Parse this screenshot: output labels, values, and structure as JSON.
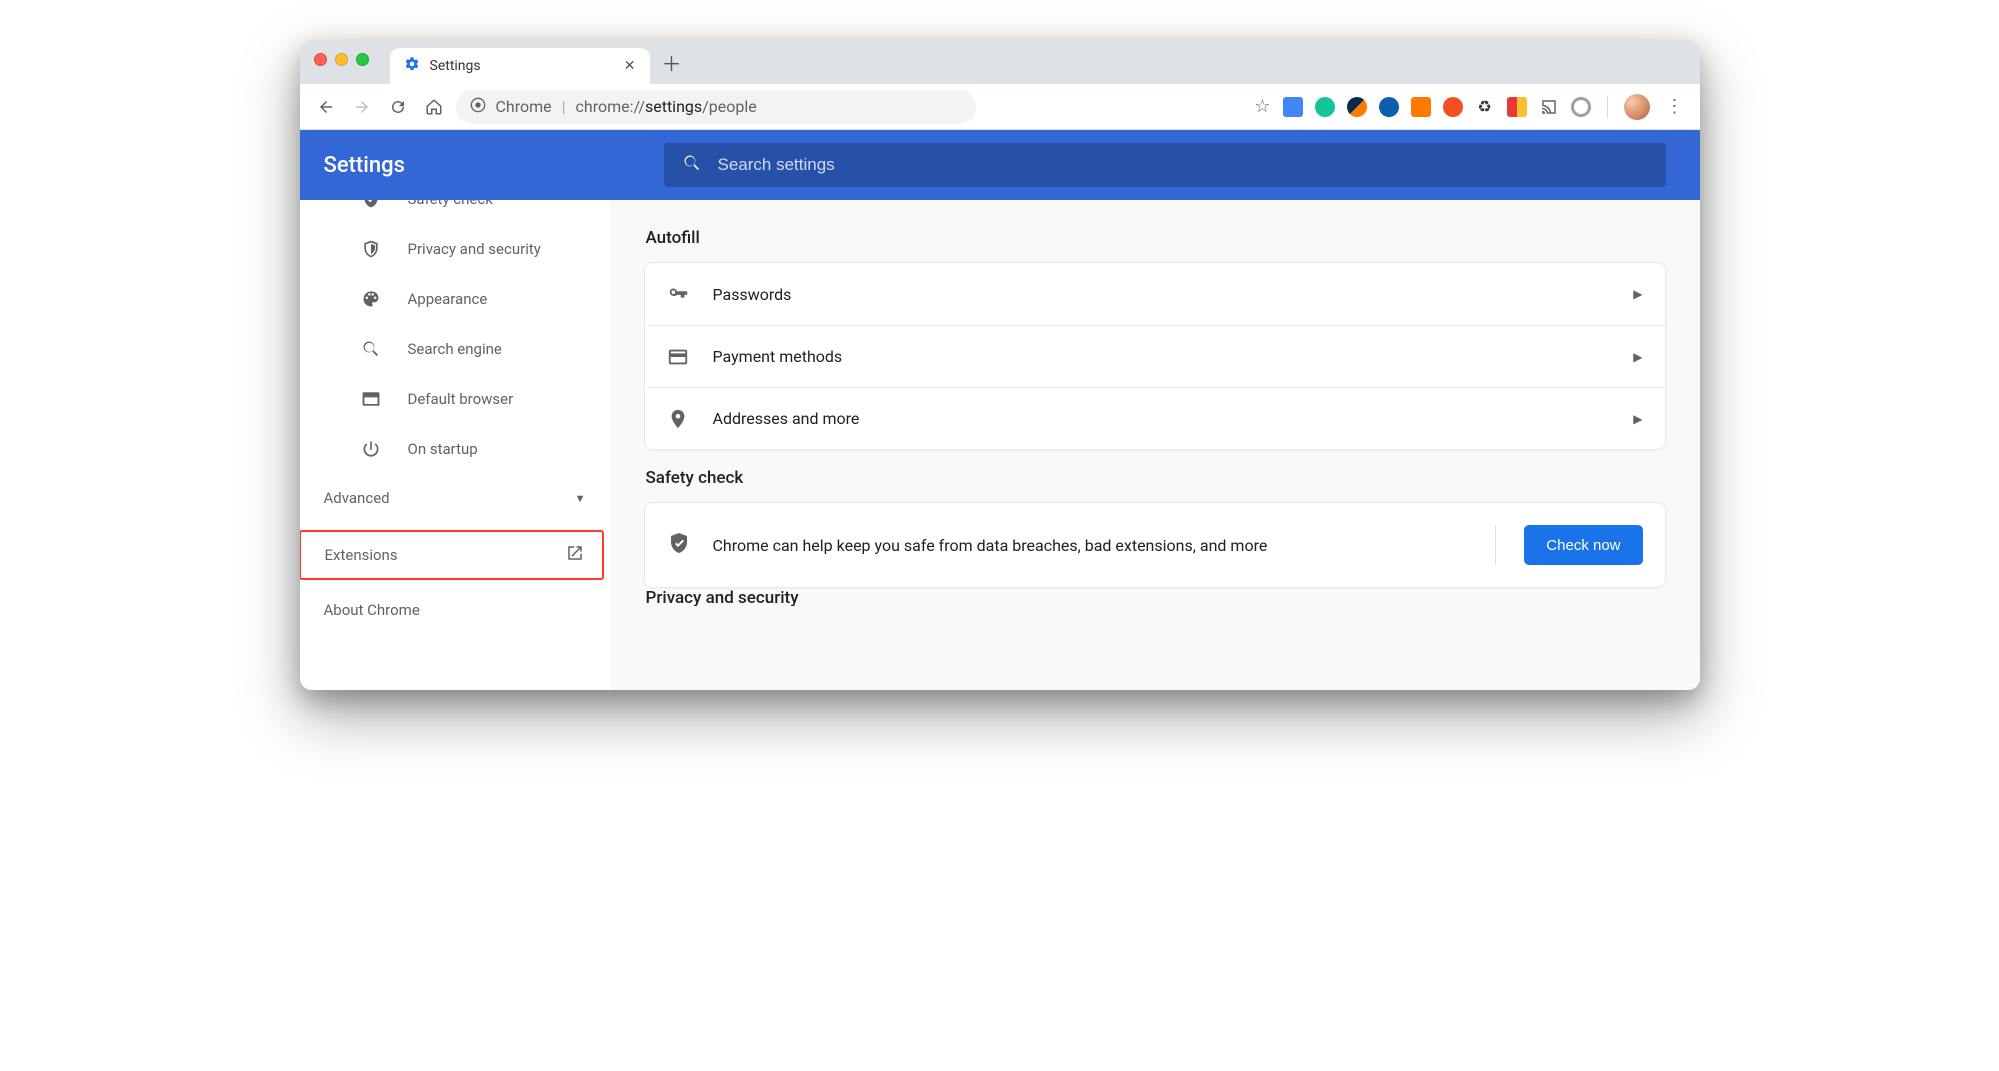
{
  "browser": {
    "tab_title": "Settings",
    "omnibox_label": "Chrome",
    "omnibox_url_prefix": "chrome://",
    "omnibox_url_strong": "settings",
    "omnibox_url_suffix": "/people",
    "extension_icons": [
      "translate",
      "grammarly",
      "similarweb",
      "amazon",
      "analytics",
      "tomato",
      "recycle",
      "bookmark",
      "cast",
      "circle"
    ]
  },
  "header": {
    "title": "Settings",
    "search_placeholder": "Search settings"
  },
  "sidebar": {
    "items": [
      {
        "label": "Safety check"
      },
      {
        "label": "Privacy and security"
      },
      {
        "label": "Appearance"
      },
      {
        "label": "Search engine"
      },
      {
        "label": "Default browser"
      },
      {
        "label": "On startup"
      }
    ],
    "advanced": "Advanced",
    "extensions": "Extensions",
    "about": "About Chrome"
  },
  "main": {
    "sections": {
      "autofill": {
        "title": "Autofill",
        "rows": [
          "Passwords",
          "Payment methods",
          "Addresses and more"
        ]
      },
      "safety": {
        "title": "Safety check",
        "text": "Chrome can help keep you safe from data breaches, bad extensions, and more",
        "button": "Check now"
      },
      "priv_cut": "Privacy and security"
    }
  }
}
